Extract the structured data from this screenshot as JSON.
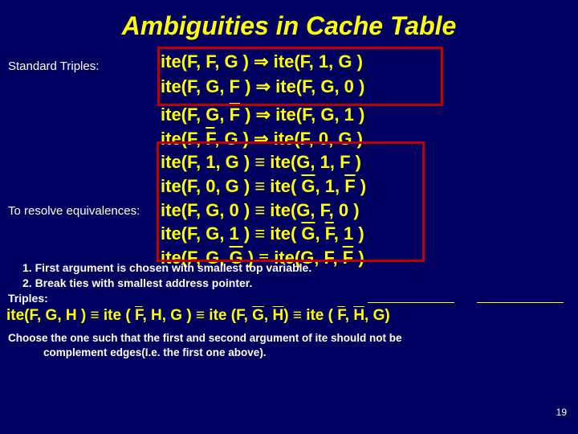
{
  "title": "Ambiguities in Cache Table",
  "labels": {
    "standard": "Standard Triples:",
    "resolve": "To resolve equivalences:",
    "triples": "Triples:"
  },
  "std": {
    "l1_left": "ite(F, F, G )",
    "l1_right": "ite(F, 1, G )",
    "l2_left": "ite(F, G, F )",
    "l2_right": "ite(F, G, 0 )"
  },
  "res": {
    "r1l": "ite(F, G, ",
    "r1m": "F",
    "r1r": " ) ⇒ ite(F, G, 1 )",
    "r2l": "ite(F, ",
    "r2m": "F",
    "r2r": ", G ) ⇒ ite(F, 0, G )",
    "r3": "ite(F, 1, G ) ≡ ite(G, 1, F )",
    "r4l": "ite(F, 0, G ) ≡ ite( ",
    "r4g": "G",
    "r4m": ", 1, ",
    "r4f": "F",
    "r4r": " )",
    "r5": "ite(F, G, 0 ) ≡ ite(G, F, 0 )",
    "r6l": "ite(F, G, 1 ) ≡ ite( ",
    "r6g": "G",
    "r6m": ", ",
    "r6f": "F",
    "r6r": ", 1 )",
    "r7l": "ite(F, G, ",
    "r7g1": "G",
    "r7m": " ) ≡ ite(G, F, ",
    "r7f": "F",
    "r7r": " )"
  },
  "notes": {
    "n1": "1. First argument is chosen with smallest top variable.",
    "n2": "2. Break ties with smallest address pointer."
  },
  "bottom": {
    "a": "ite(F, G, H ) ≡ ite ( ",
    "fb": "F",
    "b": ", H, G ) ≡ ite (F, ",
    "gb": "G",
    "c": ", ",
    "hb": "H",
    "d": ") ≡ ite ( ",
    "fb2": "F",
    "e": ", ",
    "hb2": "H",
    "f": ", G)"
  },
  "choose": {
    "l1": "Choose the one such that the first and second argument of ite should not be",
    "l2": "complement edges(I.e. the first one above)."
  },
  "page": "19"
}
